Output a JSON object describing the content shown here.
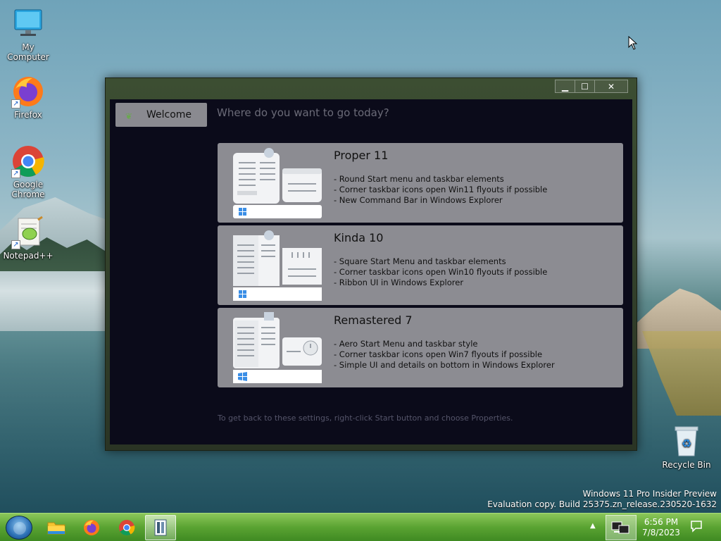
{
  "desktop": {
    "icons": [
      {
        "label": "My Computer"
      },
      {
        "label": "Firefox"
      },
      {
        "label": "Google Chrome"
      },
      {
        "label": "Notepad++"
      },
      {
        "label": "Recycle Bin"
      }
    ],
    "watermark": {
      "line1": "Windows 11 Pro Insider Preview",
      "line2": "Evaluation copy. Build 25375.zn_release.230520-1632"
    }
  },
  "window": {
    "caption_buttons": {
      "minimize": "minimize-icon",
      "maximize": "maximize-icon",
      "close": "close-icon"
    },
    "sidebar": {
      "welcome_label": "Welcome"
    },
    "prompt": "Where do you want to go today?",
    "options": [
      {
        "title": "Proper 11",
        "bullets": [
          "- Round Start menu and taskbar elements",
          "- Corner taskbar icons open Win11 flyouts if possible",
          "- New Command Bar in Windows Explorer"
        ]
      },
      {
        "title": "Kinda 10",
        "bullets": [
          "- Square Start Menu and taskbar elements",
          "- Corner taskbar icons open Win10 flyouts if possible",
          "- Ribbon UI in Windows Explorer"
        ]
      },
      {
        "title": "Remastered 7",
        "bullets": [
          "- Aero Start Menu and taskbar style",
          "- Corner taskbar icons open Win7 flyouts if possible",
          "- Simple UI and details on bottom in Windows Explorer"
        ]
      }
    ],
    "footer_hint": "To get back to these settings, right-click Start button and choose Properties."
  },
  "taskbar": {
    "apps": [
      "file-explorer-icon",
      "firefox-icon",
      "chrome-icon",
      "document-app-icon"
    ],
    "clock": {
      "time": "6:56 PM",
      "date": "7/8/2023"
    }
  },
  "colors": {
    "taskbar": "#5aa332",
    "card": "#8c8c92",
    "window_bg": "#0b0b1a"
  }
}
